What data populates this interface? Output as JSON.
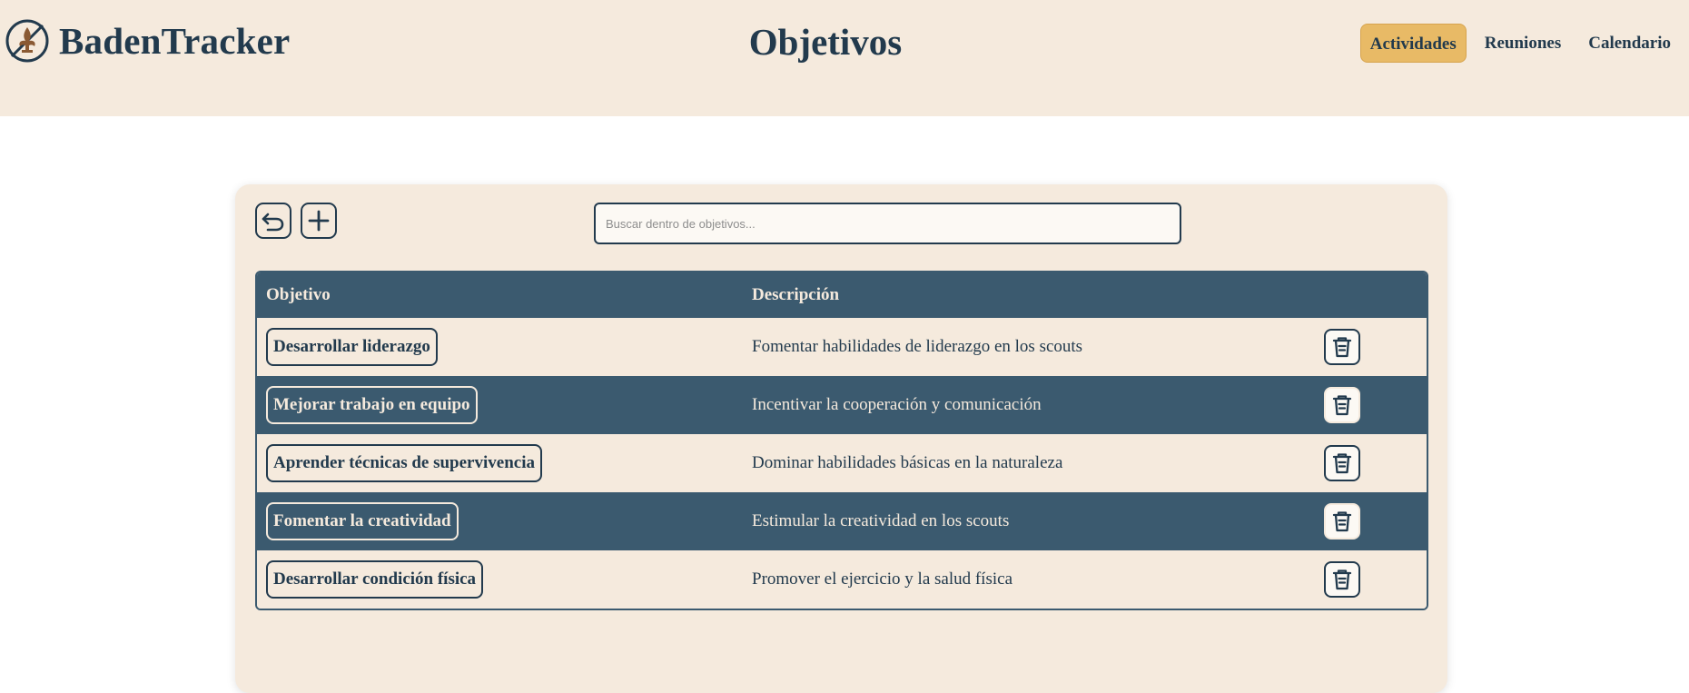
{
  "brand": {
    "name": "BadenTracker",
    "logo_icon": "fleur-de-lis-compass-icon"
  },
  "page": {
    "title": "Objetivos"
  },
  "nav": {
    "items": [
      {
        "label": "Actividades",
        "active": true
      },
      {
        "label": "Reuniones",
        "active": false
      },
      {
        "label": "Calendario",
        "active": false
      }
    ]
  },
  "toolbar": {
    "back_icon": "undo-arrow-icon",
    "add_icon": "plus-icon",
    "search_placeholder": "Buscar dentro de objetivos..."
  },
  "table": {
    "columns": [
      "Objetivo",
      "Descripción"
    ],
    "rows": [
      {
        "objetivo": "Desarrollar liderazgo",
        "descripcion": "Fomentar habilidades de liderazgo en los scouts"
      },
      {
        "objetivo": "Mejorar trabajo en equipo",
        "descripcion": "Incentivar la cooperación y comunicación"
      },
      {
        "objetivo": "Aprender técnicas de supervivencia",
        "descripcion": "Dominar habilidades básicas en la naturaleza"
      },
      {
        "objetivo": "Fomentar la creatividad",
        "descripcion": "Estimular la creatividad en los scouts"
      },
      {
        "objetivo": "Desarrollar condición física",
        "descripcion": "Promover el ejercicio y la salud física"
      }
    ],
    "row_action_icon": "trash-icon"
  },
  "colors": {
    "header_bg": "#f5eadd",
    "primary": "#223a4d",
    "table_dark": "#3b5a6f",
    "accent": "#e8ba66"
  }
}
